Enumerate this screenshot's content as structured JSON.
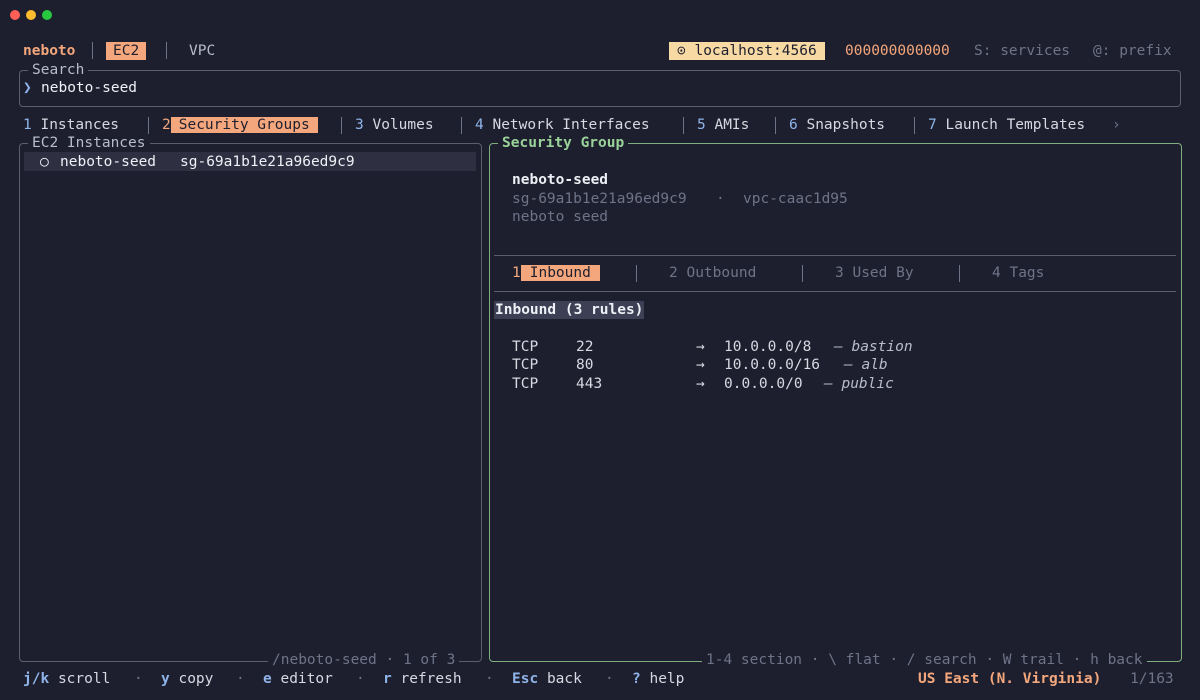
{
  "window": {
    "dots": {
      "close": "#ff5f57",
      "minimize": "#febc2e",
      "maximize": "#28c840"
    }
  },
  "header": {
    "app_name": "neboto",
    "tabs": [
      {
        "label": "EC2",
        "active": true
      },
      {
        "label": "VPC",
        "active": false
      }
    ],
    "endpoint": "⊙ localhost:4566",
    "account": "000000000000",
    "hint_services": "S: services",
    "hint_prefix": "@: prefix"
  },
  "search": {
    "label": "Search",
    "prompt": "❯",
    "value": "neboto-seed"
  },
  "resource_tabs": [
    {
      "num": "1",
      "label": "Instances",
      "active": false
    },
    {
      "num": "2",
      "label": "Security Groups",
      "active": true
    },
    {
      "num": "3",
      "label": "Volumes",
      "active": false
    },
    {
      "num": "4",
      "label": "Network Interfaces",
      "active": false
    },
    {
      "num": "5",
      "label": "AMIs",
      "active": false
    },
    {
      "num": "6",
      "label": "Snapshots",
      "active": false
    },
    {
      "num": "7",
      "label": "Launch Templates",
      "active": false
    }
  ],
  "resource_tabs_more": "›",
  "left_panel": {
    "title": "EC2 Instances",
    "items": [
      {
        "marker": "○",
        "name": "neboto-seed",
        "id": "sg-69a1b1e21a96ed9c9"
      }
    ],
    "footer": "/neboto-seed · 1 of 3"
  },
  "right_panel": {
    "title": "Security Group",
    "detail": {
      "name": "neboto-seed",
      "id": "sg-69a1b1e21a96ed9c9",
      "sep": "·",
      "vpc": "vpc-caac1d95",
      "description": "neboto seed"
    },
    "subtabs": [
      {
        "num": "1",
        "label": "Inbound",
        "active": true
      },
      {
        "num": "2",
        "label": "Outbound",
        "active": false
      },
      {
        "num": "3",
        "label": "Used By",
        "active": false
      },
      {
        "num": "4",
        "label": "Tags",
        "active": false
      }
    ],
    "section_title": "Inbound (3 rules)",
    "rules": [
      {
        "proto": "TCP",
        "port": "22",
        "arrow": "→",
        "cidr": "10.0.0.0/8",
        "note": "— bastion"
      },
      {
        "proto": "TCP",
        "port": "80",
        "arrow": "→",
        "cidr": "10.0.0.0/16",
        "note": "— alb"
      },
      {
        "proto": "TCP",
        "port": "443",
        "arrow": "→",
        "cidr": "0.0.0.0/0",
        "note": "— public"
      }
    ],
    "footer": "1-4 section · \\ flat · / search · W trail · h back"
  },
  "statusbar": {
    "keys": [
      {
        "key": "j/k",
        "label": "scroll"
      },
      {
        "key": "y",
        "label": "copy"
      },
      {
        "key": "e",
        "label": "editor"
      },
      {
        "key": "r",
        "label": "refresh"
      },
      {
        "key": "Esc",
        "label": "back"
      },
      {
        "key": "?",
        "label": "help"
      }
    ],
    "separator": "·",
    "region": "US East (N. Virginia)",
    "position": "1/163"
  }
}
